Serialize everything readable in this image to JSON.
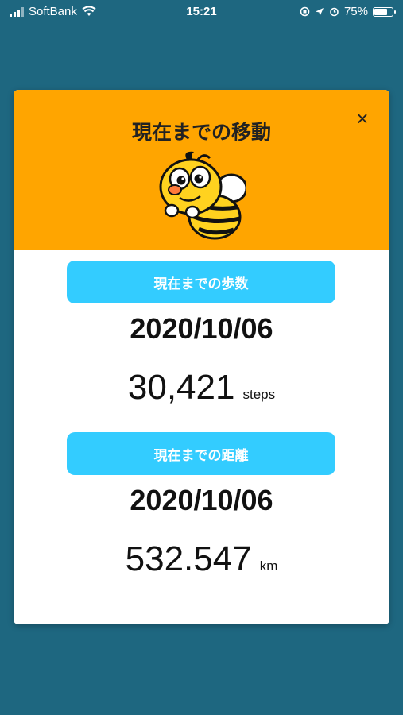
{
  "status_bar": {
    "carrier": "SoftBank",
    "time": "15:21",
    "battery": "75%",
    "battery_level": 0.75
  },
  "modal": {
    "title": "現在までの移動",
    "close_label": "×",
    "steps_section": {
      "label": "現在までの歩数",
      "date": "2020/10/06",
      "value": "30,421",
      "unit": "steps"
    },
    "distance_section": {
      "label": "現在までの距離",
      "date": "2020/10/06",
      "value": "532.547",
      "unit": "km"
    }
  },
  "colors": {
    "background": "#1e6780",
    "header": "#ffa500",
    "pill": "#33ccff"
  }
}
